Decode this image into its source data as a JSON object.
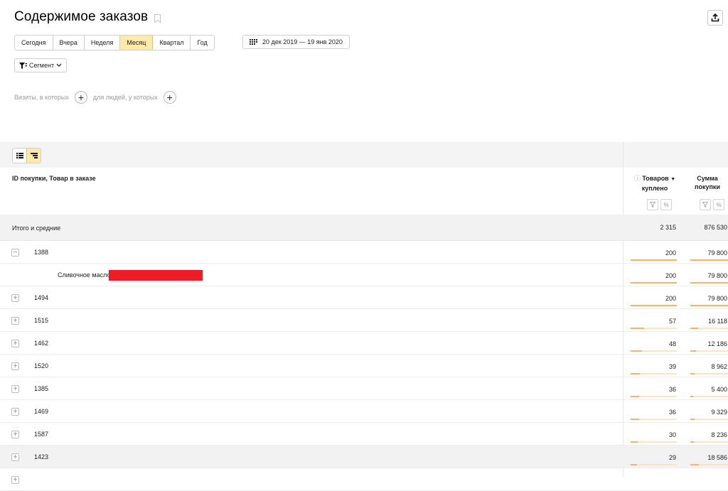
{
  "header": {
    "title": "Содержимое заказов",
    "export_icon": "share-upload-icon",
    "bookmark_icon": "bookmark-icon"
  },
  "periods": [
    "Сегодня",
    "Вчера",
    "Неделя",
    "Месяц",
    "Квартал",
    "Год"
  ],
  "active_period": "Месяц",
  "date_range": "20 дек 2019 — 19 янв 2020",
  "segment_label": "Сегмент",
  "filters": {
    "visits_label": "Визиты, в которых",
    "people_label": "для людей, у которых"
  },
  "table": {
    "dimension_header": "ID покупки, Товар в заказе",
    "metrics": [
      {
        "line1": "Товаров",
        "line2": "куплено",
        "sorted": true,
        "sort_icon": "sort-desc-icon"
      },
      {
        "line1": "Сумма",
        "line2": "покупки",
        "sorted": false
      }
    ],
    "totals": {
      "label": "Итого и средние",
      "items": "2 315",
      "amount": "876 530"
    },
    "rows": [
      {
        "label": "1388",
        "expanded": true,
        "items": "200",
        "amount": "79 800",
        "items_frac": 1.0,
        "amount_frac": 1.0
      },
      {
        "label": "Сливочное масло",
        "child": true,
        "items": "200",
        "amount": "79 800",
        "items_frac": 1.0,
        "amount_frac": 1.0
      },
      {
        "label": "1494",
        "items": "200",
        "amount": "79 800",
        "items_frac": 1.0,
        "amount_frac": 1.0
      },
      {
        "label": "1515",
        "items": "57",
        "amount": "16 118",
        "items_frac": 0.285,
        "amount_frac": 0.202
      },
      {
        "label": "1462",
        "items": "48",
        "amount": "12 186",
        "items_frac": 0.24,
        "amount_frac": 0.153
      },
      {
        "label": "1520",
        "items": "39",
        "amount": "8 962",
        "items_frac": 0.195,
        "amount_frac": 0.112
      },
      {
        "label": "1385",
        "items": "36",
        "amount": "5 400",
        "items_frac": 0.18,
        "amount_frac": 0.068
      },
      {
        "label": "1469",
        "items": "36",
        "amount": "9 329",
        "items_frac": 0.18,
        "amount_frac": 0.117
      },
      {
        "label": "1587",
        "items": "30",
        "amount": "8 236",
        "items_frac": 0.15,
        "amount_frac": 0.103
      },
      {
        "label": "1423",
        "items": "29",
        "amount": "18 586",
        "items_frac": 0.145,
        "amount_frac": 0.233,
        "hover": true
      }
    ]
  }
}
